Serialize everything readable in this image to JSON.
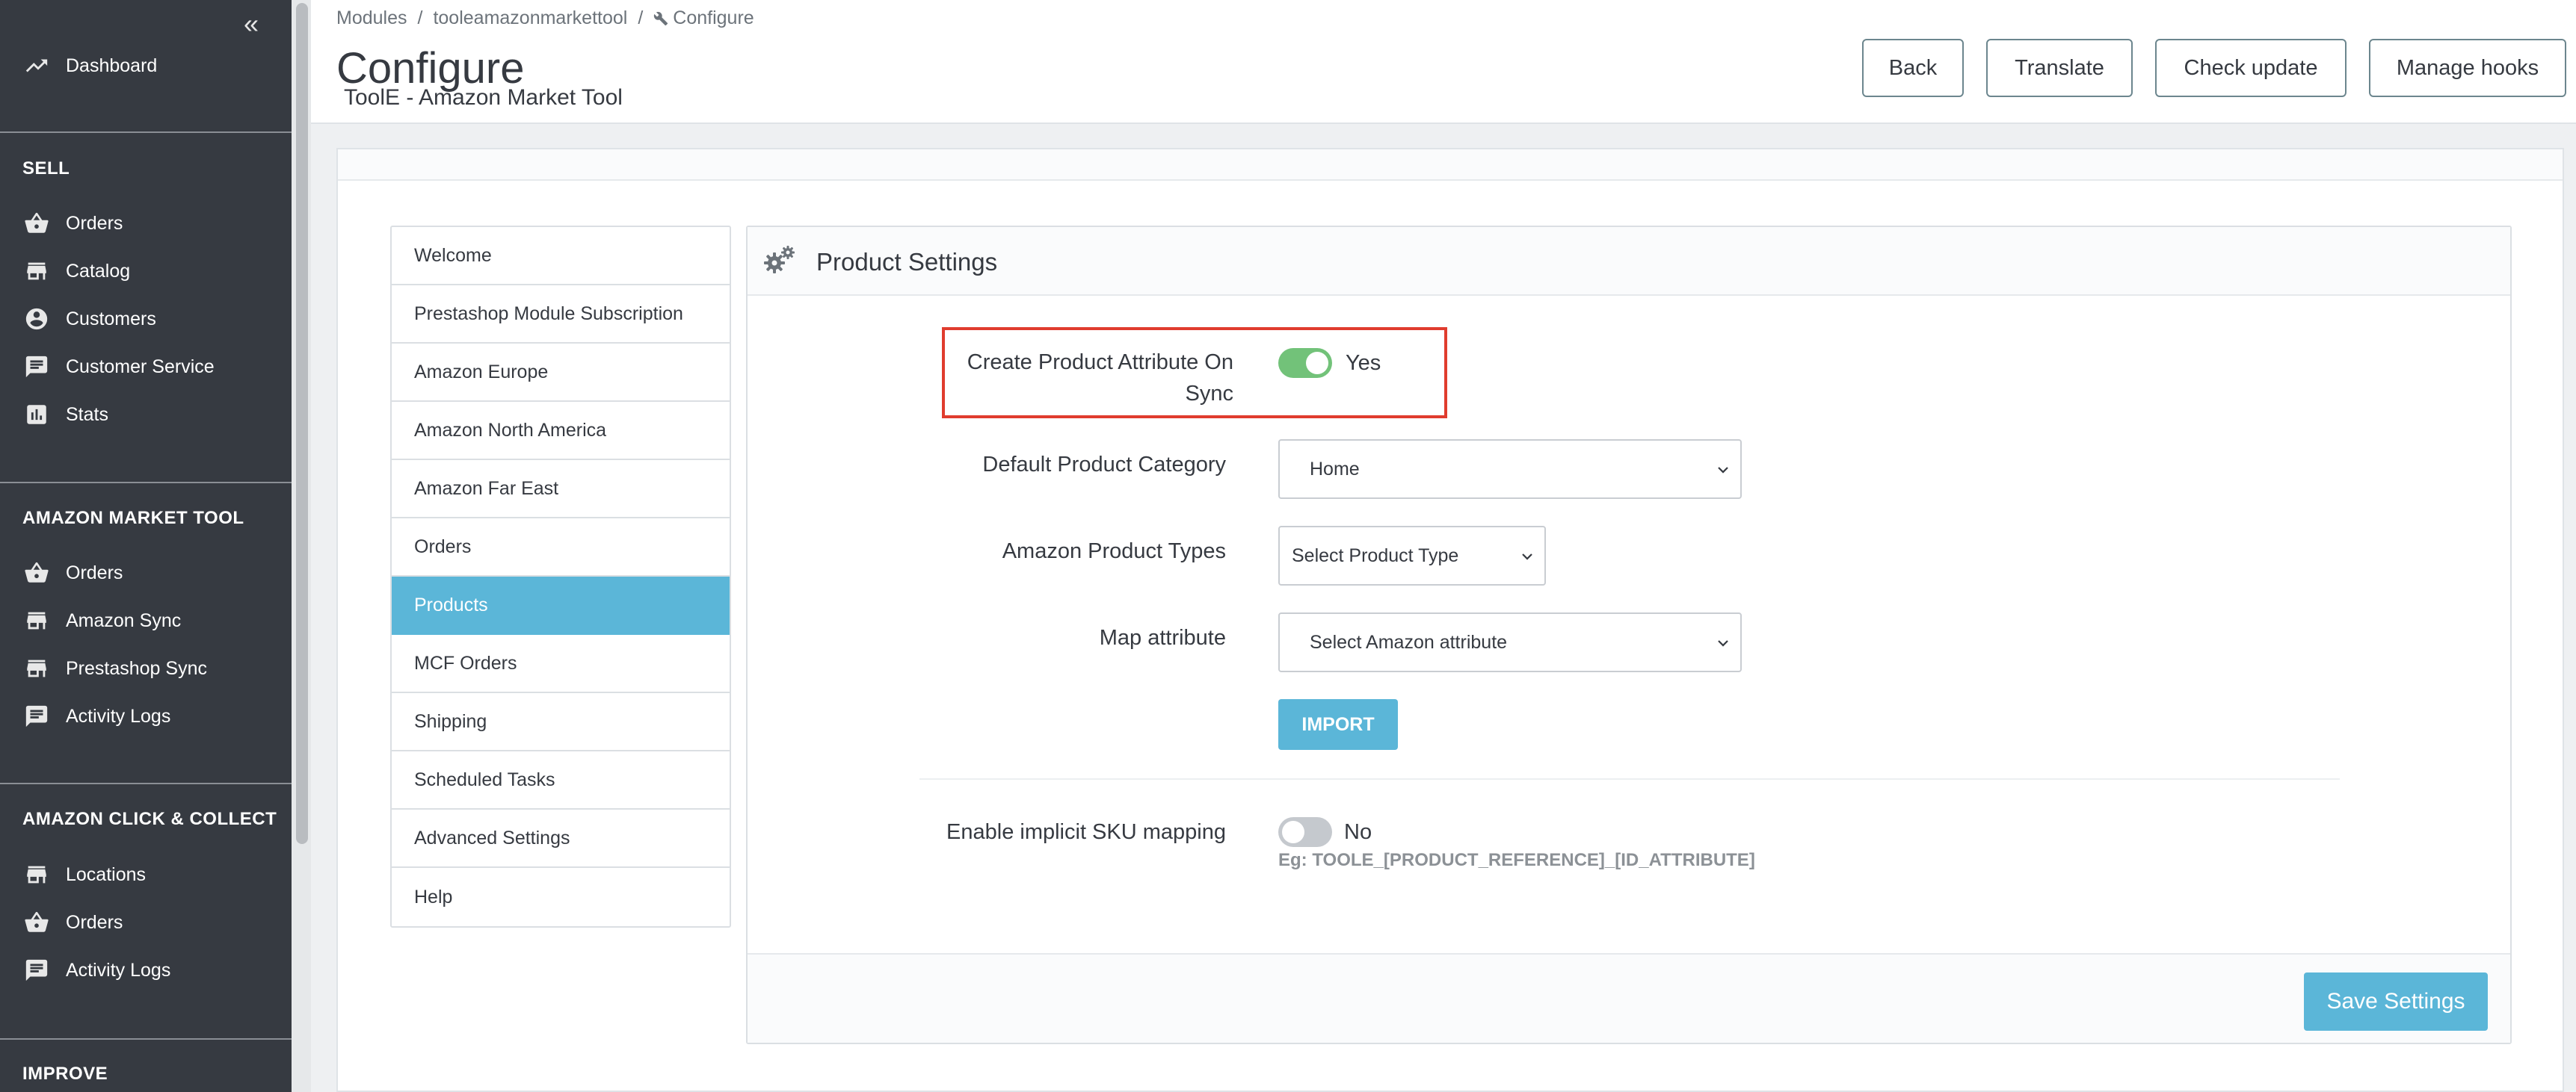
{
  "sidebar": {
    "dashboard": {
      "label": "Dashboard",
      "icon": "trending-up-icon"
    },
    "sections": [
      {
        "title": "SELL",
        "items": [
          {
            "label": "Orders",
            "icon": "basket-icon"
          },
          {
            "label": "Catalog",
            "icon": "store-icon"
          },
          {
            "label": "Customers",
            "icon": "account-circle-icon"
          },
          {
            "label": "Customer Service",
            "icon": "chat-icon"
          },
          {
            "label": "Stats",
            "icon": "bar-chart-icon"
          }
        ]
      },
      {
        "title": "AMAZON MARKET TOOL",
        "items": [
          {
            "label": "Orders",
            "icon": "basket-icon"
          },
          {
            "label": "Amazon Sync",
            "icon": "store-icon"
          },
          {
            "label": "Prestashop Sync",
            "icon": "store-icon"
          },
          {
            "label": "Activity Logs",
            "icon": "chat-icon"
          }
        ]
      },
      {
        "title": "AMAZON CLICK & COLLECT",
        "items": [
          {
            "label": "Locations",
            "icon": "store-icon"
          },
          {
            "label": "Orders",
            "icon": "basket-icon"
          },
          {
            "label": "Activity Logs",
            "icon": "chat-icon"
          }
        ]
      },
      {
        "title": "IMPROVE",
        "items": []
      }
    ]
  },
  "breadcrumb": [
    "Modules",
    "tooleamazonmarkettool",
    "Configure"
  ],
  "header": {
    "title": "Configure",
    "subtitle": "ToolE - Amazon Market Tool",
    "buttons": [
      "Back",
      "Translate",
      "Check update",
      "Manage hooks"
    ]
  },
  "tabs": [
    "Welcome",
    "Prestashop Module Subscription",
    "Amazon Europe",
    "Amazon North America",
    "Amazon Far East",
    "Orders",
    "Products",
    "MCF Orders",
    "Shipping",
    "Scheduled Tasks",
    "Advanced Settings",
    "Help"
  ],
  "active_tab": "Products",
  "panel": {
    "title": "Product Settings",
    "create_attr": {
      "label_line1": "Create Product Attribute On",
      "label_line2": "Sync",
      "state": "on",
      "value_text": "Yes"
    },
    "default_category": {
      "label": "Default Product Category",
      "value": "Home"
    },
    "product_types": {
      "label": "Amazon Product Types",
      "value": "Select Product Type"
    },
    "map_attribute": {
      "label": "Map attribute",
      "value": "Select Amazon attribute"
    },
    "import_label": "IMPORT",
    "sku_mapping": {
      "label": "Enable implicit SKU mapping",
      "state": "off",
      "value_text": "No",
      "hint": "Eg: TOOLE_[PRODUCT_REFERENCE]_[ID_ATTRIBUTE]"
    },
    "save_label": "Save Settings"
  },
  "colors": {
    "sidebar_bg": "#363a41",
    "accent": "#5bb6d8",
    "switch_on": "#72c279",
    "highlight": "#e03c2e"
  }
}
